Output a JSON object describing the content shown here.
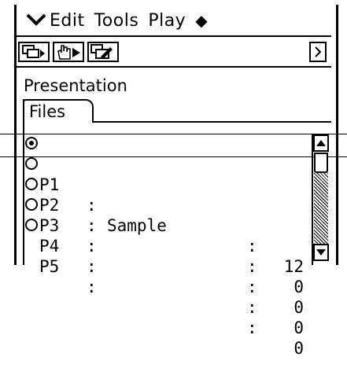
{
  "menubar": {
    "menu_icon": "menu-chevron-icon",
    "items": [
      {
        "label": "Edit"
      },
      {
        "label": "Tools"
      },
      {
        "label": "Play"
      }
    ],
    "extra_icon": "diamond-icon"
  },
  "toolbar": {
    "buttons": [
      "copy-presentation-icon",
      "auto-play-icon",
      "edit-image-icon"
    ],
    "scroll_right_icon": "chevron-right-icon"
  },
  "panel": {
    "title": "Presentation",
    "tab": "Files"
  },
  "files": [
    {
      "selected": true,
      "id": "P1",
      "sep": ":",
      "name": "Sample",
      "sep2": ":",
      "count": "12"
    },
    {
      "selected": false,
      "id": "P2",
      "sep": ":",
      "name": "",
      "sep2": ":",
      "count": "0"
    },
    {
      "selected": false,
      "id": "P3",
      "sep": ":",
      "name": "",
      "sep2": ":",
      "count": "0"
    },
    {
      "selected": false,
      "id": "P4",
      "sep": ":",
      "name": "",
      "sep2": ":",
      "count": "0"
    },
    {
      "selected": false,
      "id": "P5",
      "sep": ":",
      "name": "",
      "sep2": ":",
      "count": "0"
    }
  ],
  "scrollbar": {
    "up_icon": "arrow-up-icon",
    "down_icon": "arrow-down-icon"
  }
}
